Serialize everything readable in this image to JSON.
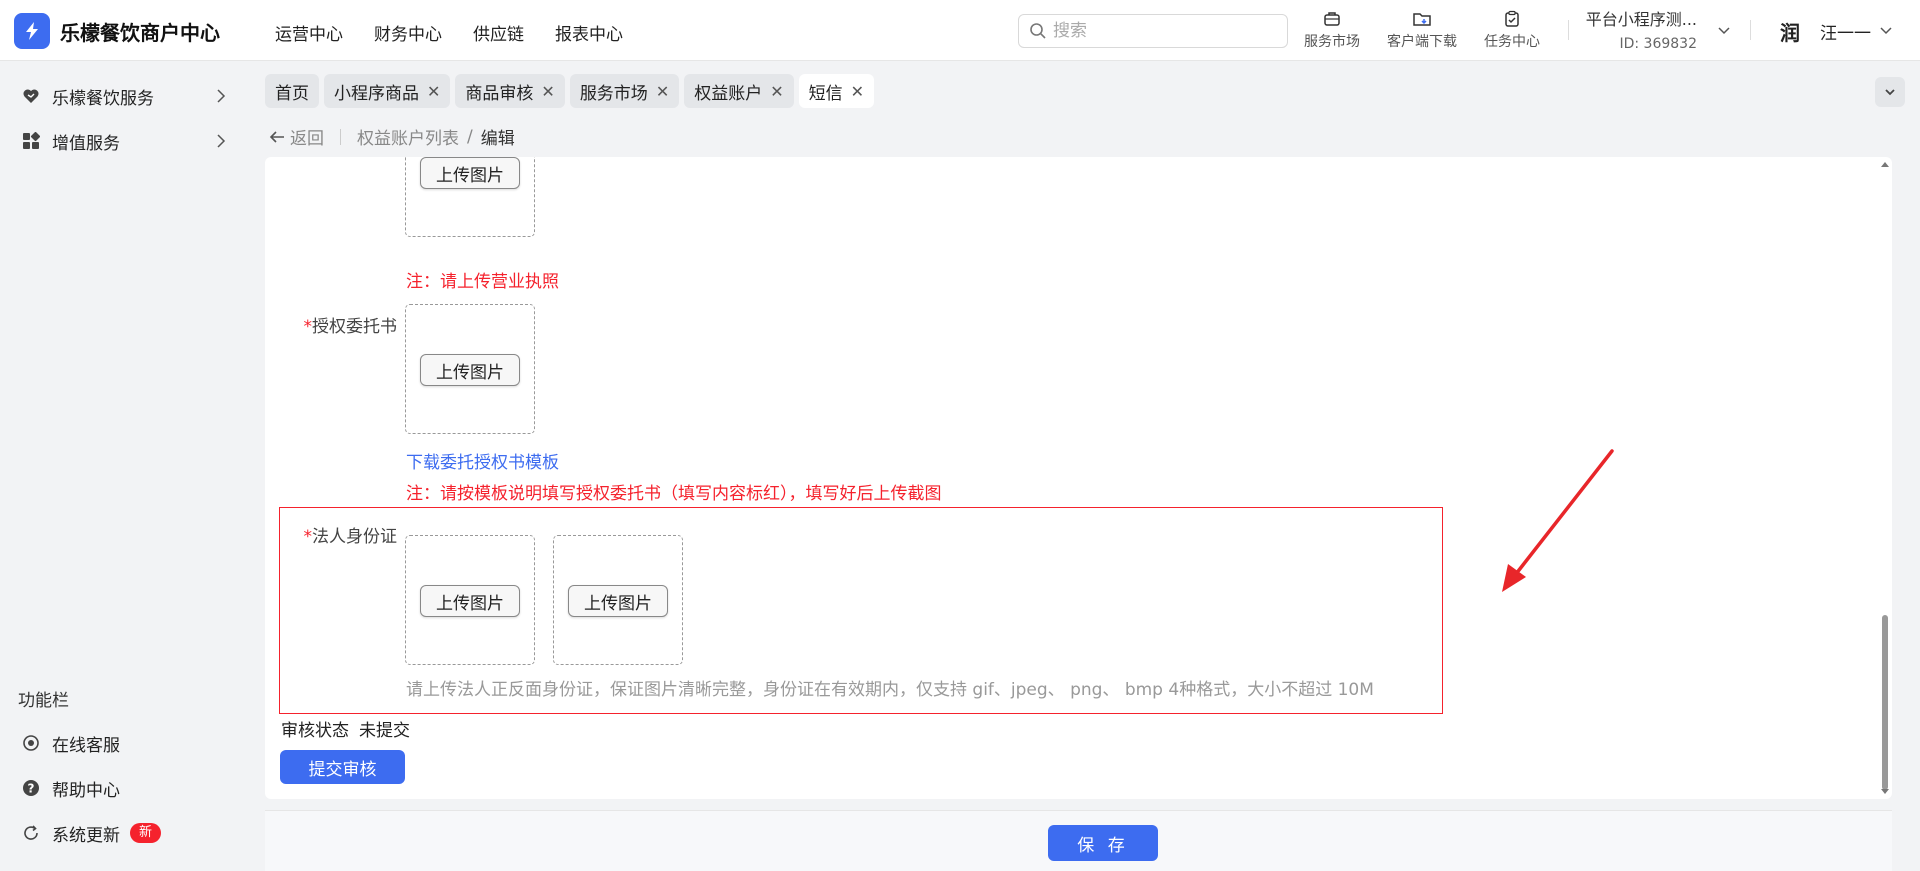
{
  "app": {
    "title": "乐檬餐饮商户中心"
  },
  "topnav": [
    "运营中心",
    "财务中心",
    "供应链",
    "报表中心"
  ],
  "search": {
    "placeholder": "搜索"
  },
  "tools": {
    "market": "服务市场",
    "download": "客户端下载",
    "tasks": "任务中心"
  },
  "store": {
    "name": "平台小程序测...",
    "id": "ID: 369832"
  },
  "user": {
    "avatar_char": "润",
    "name": "汪一一"
  },
  "sidebar": {
    "items": [
      {
        "label": "乐檬餐饮服务"
      },
      {
        "label": "增值服务"
      }
    ],
    "section_title": "功能栏",
    "bottom": [
      {
        "label": "在线客服"
      },
      {
        "label": "帮助中心"
      },
      {
        "label": "系统更新",
        "badge": "新"
      }
    ]
  },
  "tabs": [
    {
      "label": "首页"
    },
    {
      "label": "小程序商品"
    },
    {
      "label": "商品审核"
    },
    {
      "label": "服务市场"
    },
    {
      "label": "权益账户"
    },
    {
      "label": "短信"
    }
  ],
  "breadcrumb": {
    "back": "返回",
    "parent": "权益账户列表",
    "separator": "/",
    "current": "编辑"
  },
  "form": {
    "upload_label": "上传图片",
    "license_note": "注：请上传营业执照",
    "authorization": {
      "label": "授权委托书",
      "download_link": "下载委托授权书模板",
      "note": "注：请按模板说明填写授权委托书（填写内容标红），填写好后上传截图"
    },
    "legal_id": {
      "label": "法人身份证",
      "hint": "请上传法人正反面身份证，保证图片清晰完整，身份证在有效期内，仅支持 gif、jpeg、 png、 bmp 4种格式，大小不超过 10M"
    },
    "required_mark": "*",
    "review_status": {
      "label": "审核状态",
      "value": "未提交"
    },
    "submit": "提交审核"
  },
  "footer": {
    "save": "保 存"
  },
  "colors": {
    "primary": "#3d6cf0",
    "danger": "#f5222d"
  }
}
